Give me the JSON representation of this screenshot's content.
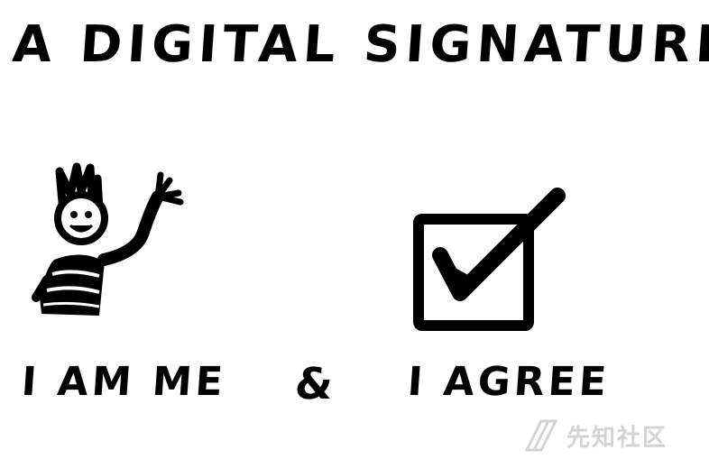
{
  "headline": "A DIGITAL SIGNATURE IS...",
  "panels": {
    "left_label": "I AM ME",
    "connector": "&",
    "right_label": "I AGREE"
  },
  "watermark": {
    "text": "先知社区",
    "logo_icon": "stripe-logo-icon"
  },
  "icons": {
    "person": "waving-person-icon",
    "checkbox": "checked-box-icon"
  },
  "colors": {
    "ink": "#000000",
    "background": "#ffffff",
    "watermark": "#cccccc"
  }
}
